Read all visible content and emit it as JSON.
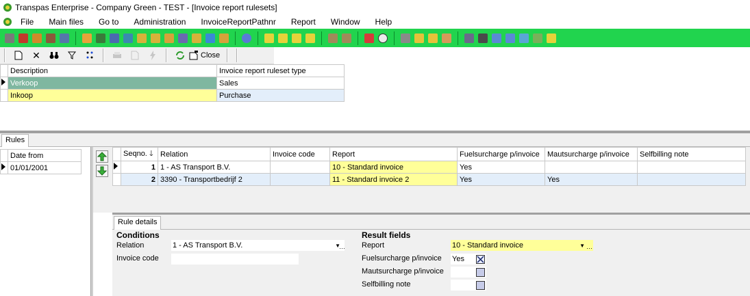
{
  "window": {
    "title": "Transpas Enterprise - Company Green - TEST - [Invoice report rulesets]"
  },
  "menu": [
    "File",
    "Main files",
    "Go to",
    "Administration",
    "InvoiceReportPathnr",
    "Report",
    "Window",
    "Help"
  ],
  "toolbar": {
    "close_label": "Close"
  },
  "rulesets": {
    "columns": [
      "Description",
      "Invoice report ruleset type"
    ],
    "rows": [
      {
        "description": "Verkoop",
        "type": "Sales"
      },
      {
        "description": "Inkoop",
        "type": "Purchase"
      }
    ]
  },
  "tabs": {
    "rules": "Rules",
    "rule_details": "Rule details"
  },
  "dates": {
    "column": "Date from",
    "rows": [
      "01/01/2001"
    ]
  },
  "rules": {
    "columns": [
      "Seqno.",
      "Relation",
      "Invoice code",
      "Report",
      "Fuelsurcharge p/invoice",
      "Mautsurcharge p/invoice",
      "Selfbilling note"
    ],
    "rows": [
      {
        "seqno": "1",
        "relation": "1 - AS Transport B.V.",
        "invoice_code": "",
        "report": "10 - Standard invoice",
        "fuel": "Yes",
        "maut": "",
        "selfbilling": ""
      },
      {
        "seqno": "2",
        "relation": "3390 - Transportbedrijf 2",
        "invoice_code": "",
        "report": "11 - Standard invoice 2",
        "fuel": "Yes",
        "maut": "Yes",
        "selfbilling": ""
      }
    ]
  },
  "details": {
    "conditions_title": "Conditions",
    "relation_label": "Relation",
    "relation_value": "1 - AS Transport B.V.",
    "invoice_code_label": "Invoice code",
    "invoice_code_value": "",
    "result_title": "Result fields",
    "report_label": "Report",
    "report_value": "10 - Standard invoice",
    "fuel_label": "Fuelsurcharge p/invoice",
    "fuel_value": "Yes",
    "fuel_checked": true,
    "maut_label": "Mautsurcharge p/invoice",
    "maut_checked": false,
    "selfbilling_label": "Selfbilling note",
    "selfbilling_checked": false
  },
  "colors": {
    "green_toolbar": "#21d44e",
    "selected_row": "#7fb7a0",
    "yellow": "#ffff99",
    "alt_row": "#e3eefa"
  }
}
